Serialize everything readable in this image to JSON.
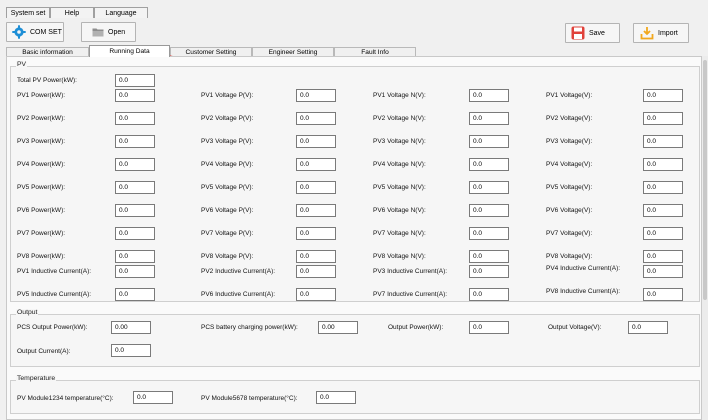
{
  "menu": {
    "items": [
      "System set",
      "Help",
      "Language"
    ]
  },
  "toolbar": {
    "com_set": "COM SET",
    "open": "Open",
    "save": "Save",
    "import": "Import"
  },
  "tabs": [
    "Basic information",
    "Running Data",
    "Customer Setting",
    "Engineer Setting",
    "Fault Info"
  ],
  "active_tab": "Running Data",
  "pv": {
    "title": "PV",
    "total_label": "Total PV Power(kW):",
    "total_value": "0.0",
    "rows": [
      [
        [
          "PV1 Power(kW):",
          "0.0"
        ],
        [
          "PV1 Voltage P(V):",
          "0.0"
        ],
        [
          "PV1 Voltage N(V):",
          "0.0"
        ],
        [
          "PV1 Voltage(V):",
          "0.0"
        ]
      ],
      [
        [
          "PV2 Power(kW):",
          "0.0"
        ],
        [
          "PV2 Voltage P(V):",
          "0.0"
        ],
        [
          "PV2 Voltage N(V):",
          "0.0"
        ],
        [
          "PV2 Voltage(V):",
          "0.0"
        ]
      ],
      [
        [
          "PV3 Power(kW):",
          "0.0"
        ],
        [
          "PV3 Voltage P(V):",
          "0.0"
        ],
        [
          "PV3 Voltage N(V):",
          "0.0"
        ],
        [
          "PV3 Voltage(V):",
          "0.0"
        ]
      ],
      [
        [
          "PV4 Power(kW):",
          "0.0"
        ],
        [
          "PV4 Voltage P(V):",
          "0.0"
        ],
        [
          "PV4 Voltage N(V):",
          "0.0"
        ],
        [
          "PV4 Voltage(V):",
          "0.0"
        ]
      ],
      [
        [
          "PV5 Power(kW):",
          "0.0"
        ],
        [
          "PV5 Voltage P(V):",
          "0.0"
        ],
        [
          "PV5 Voltage N(V):",
          "0.0"
        ],
        [
          "PV5 Voltage(V):",
          "0.0"
        ]
      ],
      [
        [
          "PV6 Power(kW):",
          "0.0"
        ],
        [
          "PV6 Voltage P(V):",
          "0.0"
        ],
        [
          "PV6 Voltage N(V):",
          "0.0"
        ],
        [
          "PV6 Voltage(V):",
          "0.0"
        ]
      ],
      [
        [
          "PV7 Power(kW):",
          "0.0"
        ],
        [
          "PV7 Voltage P(V):",
          "0.0"
        ],
        [
          "PV7 Voltage N(V):",
          "0.0"
        ],
        [
          "PV7 Voltage(V):",
          "0.0"
        ]
      ],
      [
        [
          "PV8 Power(kW):",
          "0.0"
        ],
        [
          "PV8 Voltage P(V):",
          "0.0"
        ],
        [
          "PV8 Voltage N(V):",
          "0.0"
        ],
        [
          "PV8 Voltage(V):",
          "0.0"
        ]
      ],
      [
        [
          "PV1 Inductive Current(A):",
          "0.0"
        ],
        [
          "PV2 Inductive Current(A):",
          "0.0"
        ],
        [
          "PV3 Inductive Current(A):",
          "0.0"
        ],
        [
          "PV4 Inductive Current(A):",
          "0.0"
        ]
      ],
      [
        [
          "PV5 Inductive Current(A):",
          "0.0"
        ],
        [
          "PV6 Inductive Current(A):",
          "0.0"
        ],
        [
          "PV7 Inductive Current(A):",
          "0.0"
        ],
        [
          "PV8 Inductive Current(A):",
          "0.0"
        ]
      ]
    ]
  },
  "output": {
    "title": "Output",
    "row1": [
      [
        "PCS Output Power(kW):",
        "0.00"
      ],
      [
        "PCS battery charging power(kW):",
        "0.00"
      ],
      [
        "Output Power(kW):",
        "0.0"
      ],
      [
        "Output Voltage(V):",
        "0.0"
      ]
    ],
    "row2": [
      [
        "Output Current(A):",
        "0.0"
      ]
    ]
  },
  "temperature": {
    "title": "Temperature",
    "row1": [
      [
        "PV Module1234 temperature(°C):",
        "0.0"
      ],
      [
        "PV Module5678 temperature(°C):",
        "0.0"
      ]
    ]
  },
  "colors": {
    "arrow": "#e8453c",
    "save_icon": "#e0413a",
    "import_icon": "#f2a81d",
    "com_icon": "#1e8fd6"
  }
}
